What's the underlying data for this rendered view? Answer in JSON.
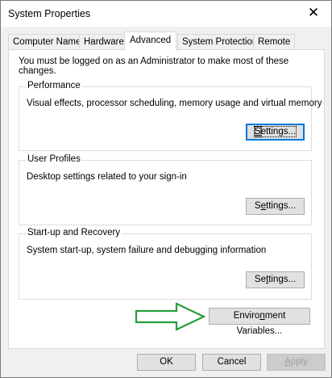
{
  "window": {
    "title": "System Properties",
    "close_glyph": "✕"
  },
  "tabs": [
    {
      "label": "Computer Name",
      "active": false
    },
    {
      "label": "Hardware",
      "active": false
    },
    {
      "label": "Advanced",
      "active": true
    },
    {
      "label": "System Protection",
      "active": false
    },
    {
      "label": "Remote",
      "active": false
    }
  ],
  "advanced": {
    "admin_note": "You must be logged on as an Administrator to make most of these changes.",
    "performance": {
      "title": "Performance",
      "description": "Visual effects, processor scheduling, memory usage and virtual memory",
      "button_pre": "",
      "button_ul": "S",
      "button_post": "ettings..."
    },
    "user_profiles": {
      "title": "User Profiles",
      "description": "Desktop settings related to your sign-in",
      "button_pre": "S",
      "button_ul": "e",
      "button_post": "ttings..."
    },
    "startup_recovery": {
      "title": "Start-up and Recovery",
      "description": "System start-up, system failure and debugging information",
      "button_pre": "Se",
      "button_ul": "t",
      "button_post": "tings..."
    },
    "env_button": {
      "pre": "Enviro",
      "ul": "n",
      "post": "ment Variables..."
    }
  },
  "footer": {
    "ok": "OK",
    "cancel": "Cancel",
    "apply_ul": "A",
    "apply_post": "pply"
  },
  "colors": {
    "arrow": "#2a9d3a",
    "focus": "#0078d7"
  }
}
